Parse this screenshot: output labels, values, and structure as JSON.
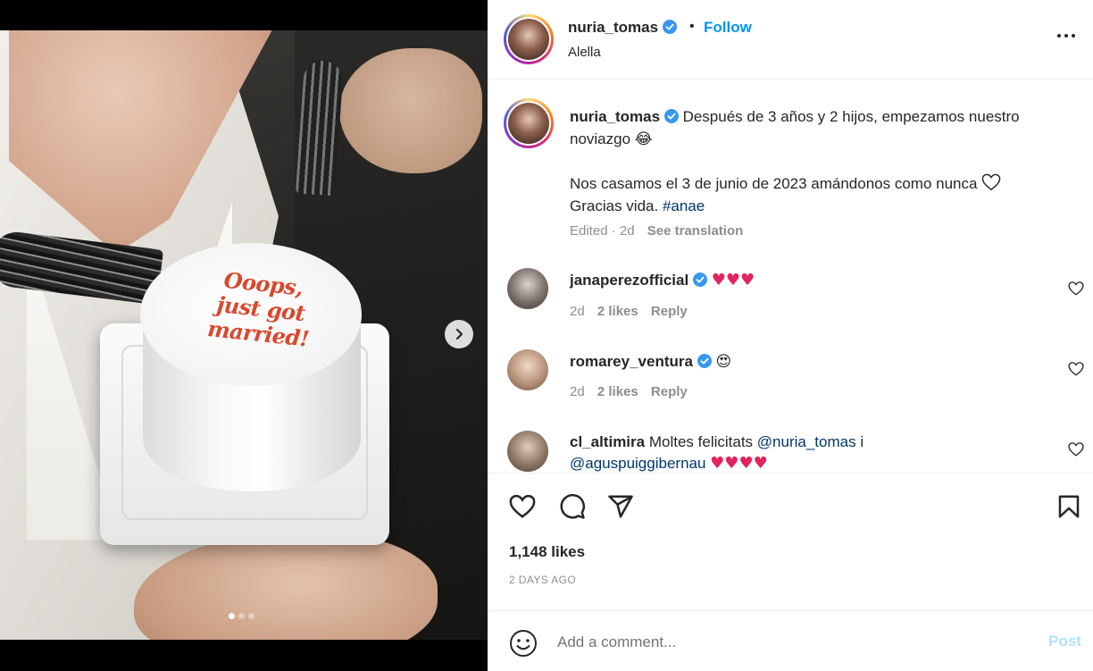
{
  "post": {
    "username": "nuria_tomas",
    "location": "Alella",
    "follow_label": "Follow",
    "separator": "•",
    "caption_line1": "Después de 3 años y 2 hijos, empezamos nuestro noviazgo",
    "caption_emoji": "😂",
    "caption_line2": "Nos casamos el 3 de junio de 2023 amándonos como nunca",
    "caption_line3_prefix": "Gracias vida.",
    "caption_hashtag": "#anae",
    "edited_label": "Edited",
    "edited_age": "· 2d",
    "see_translation": "See translation",
    "likes": "1,148 likes",
    "date": "2 DAYS AGO"
  },
  "media": {
    "cake_text_line1": "Ooops,",
    "cake_text_line2": "just got",
    "cake_text_line3": "married!",
    "slide_count": 3,
    "active_slide": 1
  },
  "comments": [
    {
      "username": "janaperezofficial",
      "text": "♥♥♥",
      "age": "2d",
      "likes": "2 likes",
      "reply": "Reply"
    },
    {
      "username": "romarey_ventura",
      "text": "😍",
      "age": "2d",
      "likes": "2 likes",
      "reply": "Reply"
    },
    {
      "username": "cl_altimira",
      "text": "Moltes felicitats",
      "mention1": "@nuria_tomas",
      "text2": "i",
      "mention2": "@aguspuiggibernau",
      "hearts": "♥♥♥♥"
    }
  ],
  "add_comment": {
    "placeholder": "Add a comment...",
    "post_label": "Post"
  },
  "icons": {
    "verified": "verified-badge-icon",
    "more": "more-options-icon",
    "like": "heart-icon",
    "comment": "comment-icon",
    "share": "send-icon",
    "save": "bookmark-icon",
    "emoji": "emoji-icon",
    "next": "chevron-right-icon"
  },
  "colors": {
    "link": "#0095f6",
    "hashtag": "#00376b",
    "muted": "#8e8e8e",
    "post_disabled": "#b2dffc",
    "verified": "#3897f0"
  }
}
